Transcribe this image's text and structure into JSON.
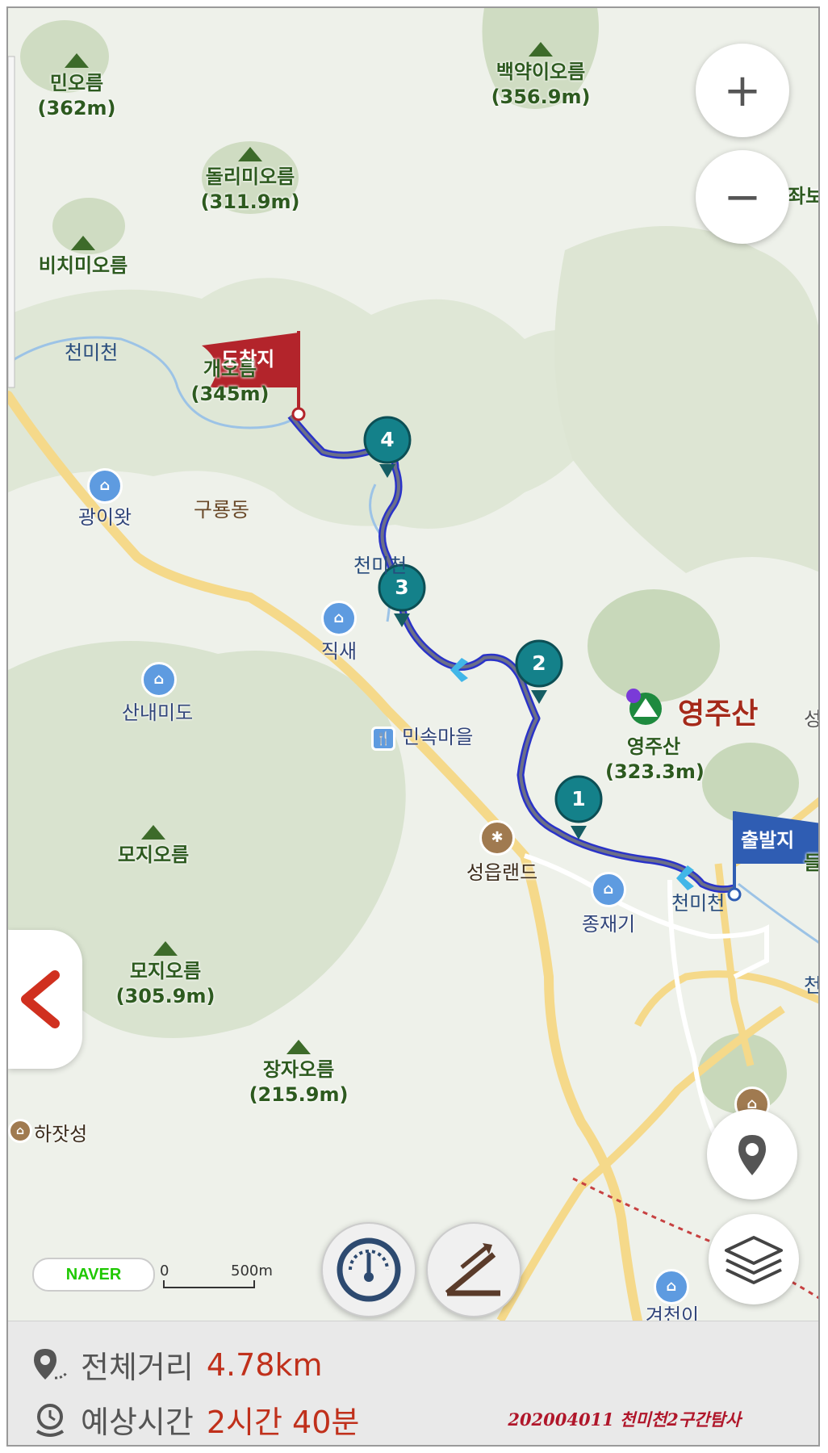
{
  "map": {
    "peaks": [
      {
        "name": "민오름",
        "elev": "(362m)"
      },
      {
        "name": "백약이오름",
        "elev": "(356.9m)"
      },
      {
        "name": "돌리미오름",
        "elev": "(311.9m)"
      },
      {
        "name": "비치미오름",
        "elev": ""
      },
      {
        "name": "개오름",
        "elev": "(345m)"
      },
      {
        "name": "영주산",
        "elev": "(323.3m)"
      },
      {
        "name": "모지오름",
        "elev": ""
      },
      {
        "name": "모지오름",
        "elev": "(305.9m)"
      },
      {
        "name": "장자오름",
        "elev": "(215.9m)"
      }
    ],
    "places": [
      {
        "name": "광이왓",
        "icon": "village-icon"
      },
      {
        "name": "직새",
        "icon": "village-icon"
      },
      {
        "name": "산내미도",
        "icon": "village-icon"
      },
      {
        "name": "민속마을",
        "icon": "restaurant-icon"
      },
      {
        "name": "성읍랜드",
        "icon": "amusement-park-icon"
      },
      {
        "name": "종재기",
        "icon": "village-icon"
      },
      {
        "name": "하잣성",
        "icon": "heritage-icon"
      },
      {
        "name": "겨천이",
        "icon": "village-icon"
      }
    ],
    "district": "구룡동",
    "streams": [
      "천미천",
      "천미천",
      "천미천",
      "천"
    ],
    "edge_labels": [
      "좌보",
      "성",
      "들",
      "천"
    ],
    "mountain_name": "영주산",
    "flags": {
      "start": "출발지",
      "end": "도착지"
    },
    "waypoints": [
      "1",
      "2",
      "3",
      "4"
    ],
    "branding": {
      "logo": "NAVER"
    },
    "scale": {
      "zero": "0",
      "distance": "500m"
    },
    "colors": {
      "route": "#2a33c8",
      "start_flag": "#2f5db3",
      "end_flag": "#b3242b",
      "waypoint": "#14818a",
      "road": "#f5d98a"
    }
  },
  "controls": {
    "zoom_in": "+",
    "zoom_out": "−"
  },
  "summary": {
    "distance_label": "전체거리",
    "distance_value": "4.78km",
    "time_label": "예상시간",
    "time_value": "2시간 40분",
    "caption": "202004011 천미천2구간탐사"
  }
}
